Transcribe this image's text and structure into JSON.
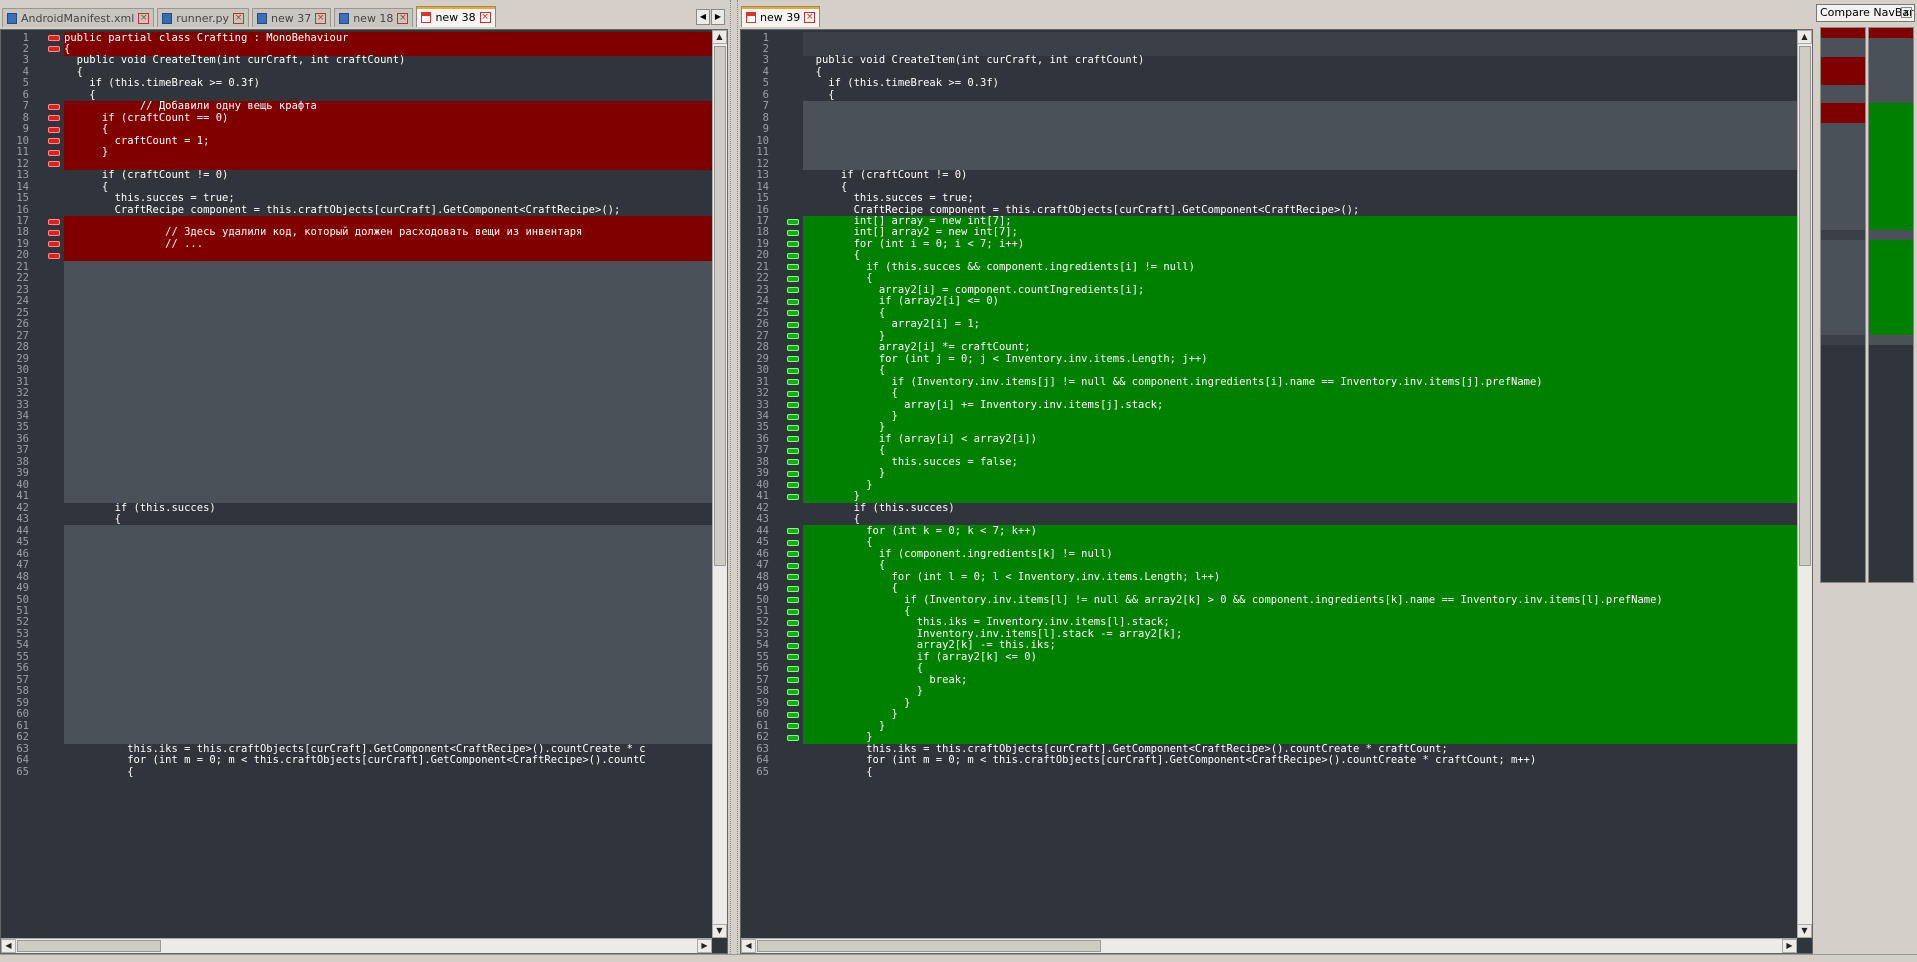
{
  "tabs_left": [
    {
      "label": "AndroidManifest.xml",
      "active": false,
      "icon": "xml-file-icon"
    },
    {
      "label": "runner.py",
      "active": false,
      "icon": "python-file-icon"
    },
    {
      "label": "new 37",
      "active": false,
      "icon": "file-icon"
    },
    {
      "label": "new 18",
      "active": false,
      "icon": "file-icon"
    },
    {
      "label": "new 38",
      "active": true,
      "icon": "file-icon"
    }
  ],
  "tabs_right": [
    {
      "label": "new 39",
      "active": true,
      "icon": "file-icon"
    }
  ],
  "navbar": {
    "title": "Compare NavBar",
    "close": "x"
  },
  "colors": {
    "deleted": "#800000",
    "added": "#008000",
    "moved_gap": "#4a5157",
    "background": "#2f353b",
    "text": "#ffffff"
  },
  "left_lines": [
    {
      "n": "1",
      "code": "public partial class Crafting : MonoBehaviour",
      "k": "del"
    },
    {
      "n": "2",
      "code": "{",
      "k": "del"
    },
    {
      "n": "3",
      "code": "  public void CreateItem(int curCraft, int craftCount)",
      "k": "n"
    },
    {
      "n": "4",
      "code": "  {",
      "k": "n"
    },
    {
      "n": "5",
      "code": "    if (this.timeBreak >= 0.3f)",
      "k": "n"
    },
    {
      "n": "6",
      "code": "    {",
      "k": "n"
    },
    {
      "n": "7",
      "code": "            // Добавили одну вещь крафта",
      "k": "del"
    },
    {
      "n": "8",
      "code": "      if (craftCount == 0)",
      "k": "del"
    },
    {
      "n": "9",
      "code": "      {",
      "k": "del"
    },
    {
      "n": "10",
      "code": "        craftCount = 1;",
      "k": "del"
    },
    {
      "n": "11",
      "code": "      }",
      "k": "del"
    },
    {
      "n": "12",
      "code": "",
      "k": "del"
    },
    {
      "n": "13",
      "code": "      if (craftCount != 0)",
      "k": "n"
    },
    {
      "n": "14",
      "code": "      {",
      "k": "n"
    },
    {
      "n": "15",
      "code": "        this.succes = true;",
      "k": "n"
    },
    {
      "n": "16",
      "code": "        CraftRecipe component = this.craftObjects[curCraft].GetComponent<CraftRecipe>();",
      "k": "n"
    },
    {
      "n": "17",
      "code": "",
      "k": "del"
    },
    {
      "n": "18",
      "code": "                // Здесь удалили код, который должен расходовать вещи из инвентаря",
      "k": "del"
    },
    {
      "n": "19",
      "code": "                // ...",
      "k": "del"
    },
    {
      "n": "20",
      "code": "",
      "k": "del"
    },
    {
      "n": "21",
      "code": "",
      "k": "gap"
    },
    {
      "n": "22",
      "code": "",
      "k": "gap"
    },
    {
      "n": "23",
      "code": "",
      "k": "gap"
    },
    {
      "n": "24",
      "code": "",
      "k": "gap"
    },
    {
      "n": "25",
      "code": "",
      "k": "gap"
    },
    {
      "n": "26",
      "code": "",
      "k": "gap"
    },
    {
      "n": "27",
      "code": "",
      "k": "gap"
    },
    {
      "n": "28",
      "code": "",
      "k": "gap"
    },
    {
      "n": "29",
      "code": "",
      "k": "gap"
    },
    {
      "n": "30",
      "code": "",
      "k": "gap"
    },
    {
      "n": "31",
      "code": "",
      "k": "gap"
    },
    {
      "n": "32",
      "code": "",
      "k": "gap"
    },
    {
      "n": "33",
      "code": "",
      "k": "gap"
    },
    {
      "n": "34",
      "code": "",
      "k": "gap"
    },
    {
      "n": "35",
      "code": "",
      "k": "gap"
    },
    {
      "n": "36",
      "code": "",
      "k": "gap"
    },
    {
      "n": "37",
      "code": "",
      "k": "gap"
    },
    {
      "n": "38",
      "code": "",
      "k": "gap"
    },
    {
      "n": "39",
      "code": "",
      "k": "gap"
    },
    {
      "n": "40",
      "code": "",
      "k": "gap"
    },
    {
      "n": "41",
      "code": "",
      "k": "gap"
    },
    {
      "n": "42",
      "code": "        if (this.succes)",
      "k": "n"
    },
    {
      "n": "43",
      "code": "        {",
      "k": "n"
    },
    {
      "n": "44",
      "code": "",
      "k": "gap"
    },
    {
      "n": "45",
      "code": "",
      "k": "gap"
    },
    {
      "n": "46",
      "code": "",
      "k": "gap"
    },
    {
      "n": "47",
      "code": "",
      "k": "gap"
    },
    {
      "n": "48",
      "code": "",
      "k": "gap"
    },
    {
      "n": "49",
      "code": "",
      "k": "gap"
    },
    {
      "n": "50",
      "code": "",
      "k": "gap"
    },
    {
      "n": "51",
      "code": "",
      "k": "gap"
    },
    {
      "n": "52",
      "code": "",
      "k": "gap"
    },
    {
      "n": "53",
      "code": "",
      "k": "gap"
    },
    {
      "n": "54",
      "code": "",
      "k": "gap"
    },
    {
      "n": "55",
      "code": "",
      "k": "gap"
    },
    {
      "n": "56",
      "code": "",
      "k": "gap"
    },
    {
      "n": "57",
      "code": "",
      "k": "gap"
    },
    {
      "n": "58",
      "code": "",
      "k": "gap"
    },
    {
      "n": "59",
      "code": "",
      "k": "gap"
    },
    {
      "n": "60",
      "code": "",
      "k": "gap"
    },
    {
      "n": "61",
      "code": "",
      "k": "gap"
    },
    {
      "n": "62",
      "code": "",
      "k": "gap"
    },
    {
      "n": "63",
      "code": "          this.iks = this.craftObjects[curCraft].GetComponent<CraftRecipe>().countCreate * c",
      "k": "n"
    },
    {
      "n": "64",
      "code": "          for (int m = 0; m < this.craftObjects[curCraft].GetComponent<CraftRecipe>().countC",
      "k": "n"
    },
    {
      "n": "65",
      "code": "          {",
      "k": "n"
    }
  ],
  "right_lines": [
    {
      "n": "1",
      "code": "",
      "k": "gapdark"
    },
    {
      "n": "2",
      "code": "",
      "k": "gapdark"
    },
    {
      "n": "3",
      "code": "  public void CreateItem(int curCraft, int craftCount)",
      "k": "n"
    },
    {
      "n": "4",
      "code": "  {",
      "k": "n"
    },
    {
      "n": "5",
      "code": "    if (this.timeBreak >= 0.3f)",
      "k": "n"
    },
    {
      "n": "6",
      "code": "    {",
      "k": "n"
    },
    {
      "n": "7",
      "code": "",
      "k": "gap"
    },
    {
      "n": "8",
      "code": "",
      "k": "gap"
    },
    {
      "n": "9",
      "code": "",
      "k": "gap"
    },
    {
      "n": "10",
      "code": "",
      "k": "gap"
    },
    {
      "n": "11",
      "code": "",
      "k": "gap"
    },
    {
      "n": "12",
      "code": "",
      "k": "gap"
    },
    {
      "n": "13",
      "code": "      if (craftCount != 0)",
      "k": "n"
    },
    {
      "n": "14",
      "code": "      {",
      "k": "n"
    },
    {
      "n": "15",
      "code": "        this.succes = true;",
      "k": "n"
    },
    {
      "n": "16",
      "code": "        CraftRecipe component = this.craftObjects[curCraft].GetComponent<CraftRecipe>();",
      "k": "n"
    },
    {
      "n": "17",
      "code": "        int[] array = new int[7];",
      "k": "add"
    },
    {
      "n": "18",
      "code": "        int[] array2 = new int[7];",
      "k": "add"
    },
    {
      "n": "19",
      "code": "        for (int i = 0; i < 7; i++)",
      "k": "add"
    },
    {
      "n": "20",
      "code": "        {",
      "k": "add"
    },
    {
      "n": "21",
      "code": "          if (this.succes && component.ingredients[i] != null)",
      "k": "add"
    },
    {
      "n": "22",
      "code": "          {",
      "k": "add"
    },
    {
      "n": "23",
      "code": "            array2[i] = component.countIngredients[i];",
      "k": "add"
    },
    {
      "n": "24",
      "code": "            if (array2[i] <= 0)",
      "k": "add"
    },
    {
      "n": "25",
      "code": "            {",
      "k": "add"
    },
    {
      "n": "26",
      "code": "              array2[i] = 1;",
      "k": "add"
    },
    {
      "n": "27",
      "code": "            }",
      "k": "add"
    },
    {
      "n": "28",
      "code": "            array2[i] *= craftCount;",
      "k": "add"
    },
    {
      "n": "29",
      "code": "            for (int j = 0; j < Inventory.inv.items.Length; j++)",
      "k": "add"
    },
    {
      "n": "30",
      "code": "            {",
      "k": "add"
    },
    {
      "n": "31",
      "code": "              if (Inventory.inv.items[j] != null && component.ingredients[i].name == Inventory.inv.items[j].prefName)",
      "k": "add"
    },
    {
      "n": "32",
      "code": "              {",
      "k": "add"
    },
    {
      "n": "33",
      "code": "                array[i] += Inventory.inv.items[j].stack;",
      "k": "add"
    },
    {
      "n": "34",
      "code": "              }",
      "k": "add"
    },
    {
      "n": "35",
      "code": "            }",
      "k": "add"
    },
    {
      "n": "36",
      "code": "            if (array[i] < array2[i])",
      "k": "add"
    },
    {
      "n": "37",
      "code": "            {",
      "k": "add"
    },
    {
      "n": "38",
      "code": "              this.succes = false;",
      "k": "add"
    },
    {
      "n": "39",
      "code": "            }",
      "k": "add"
    },
    {
      "n": "40",
      "code": "          }",
      "k": "add"
    },
    {
      "n": "41",
      "code": "        }",
      "k": "add"
    },
    {
      "n": "42",
      "code": "        if (this.succes)",
      "k": "n"
    },
    {
      "n": "43",
      "code": "        {",
      "k": "n"
    },
    {
      "n": "44",
      "code": "          for (int k = 0; k < 7; k++)",
      "k": "add"
    },
    {
      "n": "45",
      "code": "          {",
      "k": "add"
    },
    {
      "n": "46",
      "code": "            if (component.ingredients[k] != null)",
      "k": "add"
    },
    {
      "n": "47",
      "code": "            {",
      "k": "add"
    },
    {
      "n": "48",
      "code": "              for (int l = 0; l < Inventory.inv.items.Length; l++)",
      "k": "add"
    },
    {
      "n": "49",
      "code": "              {",
      "k": "add"
    },
    {
      "n": "50",
      "code": "                if (Inventory.inv.items[l] != null && array2[k] > 0 && component.ingredients[k].name == Inventory.inv.items[l].prefName)",
      "k": "add"
    },
    {
      "n": "51",
      "code": "                {",
      "k": "add"
    },
    {
      "n": "52",
      "code": "                  this.iks = Inventory.inv.items[l].stack;",
      "k": "add"
    },
    {
      "n": "53",
      "code": "                  Inventory.inv.items[l].stack -= array2[k];",
      "k": "add"
    },
    {
      "n": "54",
      "code": "                  array2[k] -= this.iks;",
      "k": "add"
    },
    {
      "n": "55",
      "code": "                  if (array2[k] <= 0)",
      "k": "add"
    },
    {
      "n": "56",
      "code": "                  {",
      "k": "add"
    },
    {
      "n": "57",
      "code": "                    break;",
      "k": "add"
    },
    {
      "n": "58",
      "code": "                  }",
      "k": "add"
    },
    {
      "n": "59",
      "code": "                }",
      "k": "add"
    },
    {
      "n": "60",
      "code": "              }",
      "k": "add"
    },
    {
      "n": "61",
      "code": "            }",
      "k": "add"
    },
    {
      "n": "62",
      "code": "          }",
      "k": "add"
    },
    {
      "n": "63",
      "code": "          this.iks = this.craftObjects[curCraft].GetComponent<CraftRecipe>().countCreate * craftCount;",
      "k": "n"
    },
    {
      "n": "64",
      "code": "          for (int m = 0; m < this.craftObjects[curCraft].GetComponent<CraftRecipe>().countCreate * craftCount; m++)",
      "k": "n"
    },
    {
      "n": "65",
      "code": "          {",
      "k": "n"
    }
  ],
  "scroll": {
    "left_vertical": "up-arrow",
    "down": "down-arrow",
    "left": "left-arrow",
    "right": "right-arrow"
  }
}
